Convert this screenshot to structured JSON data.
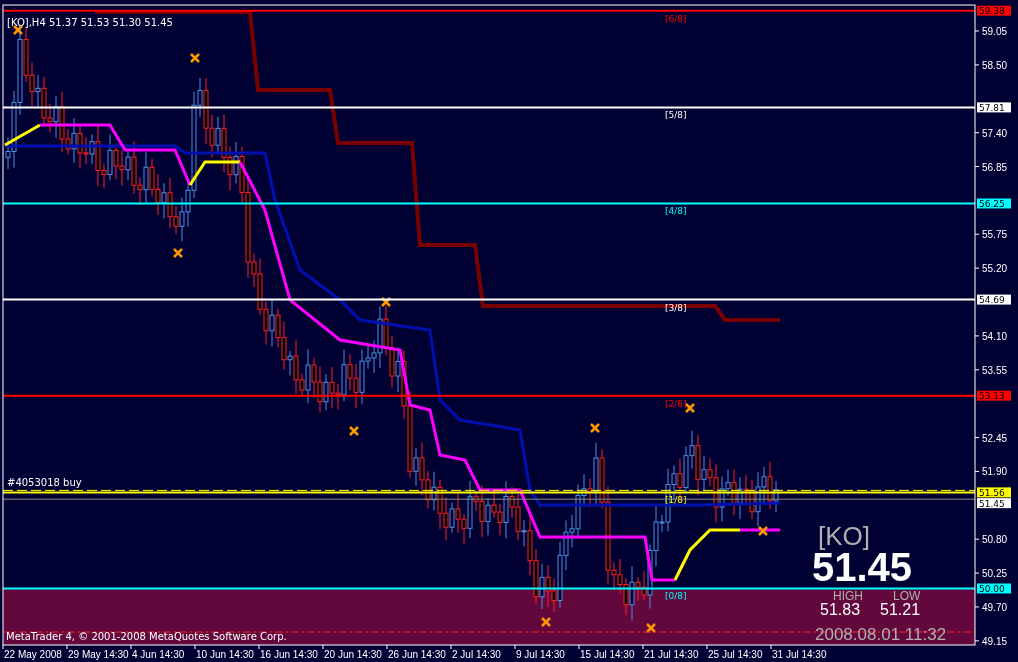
{
  "chart": {
    "header": "[KO],H4 51.37 51.53 51.30 51.45",
    "copyright": "MetaTrader 4, © 2001-2008 MetaQuotes Software Corp.",
    "order": {
      "label": "#4053018 buy"
    },
    "bid": {
      "price": "51.45"
    },
    "levels": [
      {
        "price": "59.38",
        "label": "[6/8]",
        "color": "#ff0000"
      },
      {
        "price": "57.81",
        "label": "[5/8]",
        "color": "#ffffff"
      },
      {
        "price": "56.25",
        "label": "[4/8]",
        "color": "#00ffff"
      },
      {
        "price": "54.69",
        "label": "[3/8]",
        "color": "#ffffff"
      },
      {
        "price": "53.13",
        "label": "[2/8]",
        "color": "#ff0000"
      },
      {
        "price": "51.56",
        "label": "[1/8]",
        "color": "#ffff00"
      },
      {
        "price": "50.00",
        "label": "[0/8]",
        "color": "#00ffff"
      }
    ],
    "price_ticks": [
      "59.05",
      "58.50",
      "57.40",
      "56.85",
      "55.75",
      "55.20",
      "54.10",
      "53.55",
      "52.45",
      "51.90",
      "50.80",
      "50.25",
      "49.70",
      "49.15"
    ],
    "time_ticks": [
      "22 May 2008",
      "29 May 14:30",
      "4 Jun 14:30",
      "10 Jun 14:30",
      "16 Jun 14:30",
      "20 Jun 14:30",
      "26 Jun 14:30",
      "2 Jul 14:30",
      "9 Jul 14:30",
      "15 Jul 14:30",
      "21 Jul 14:30",
      "25 Jul 14:30",
      "31 Jul 14:30"
    ]
  },
  "info": {
    "symbol": "[KO]",
    "price": "51.45",
    "high_label": "HIGH",
    "low_label": "LOW",
    "high": "51.83",
    "low": "51.21",
    "time": "2008.08.01 11:32"
  }
}
